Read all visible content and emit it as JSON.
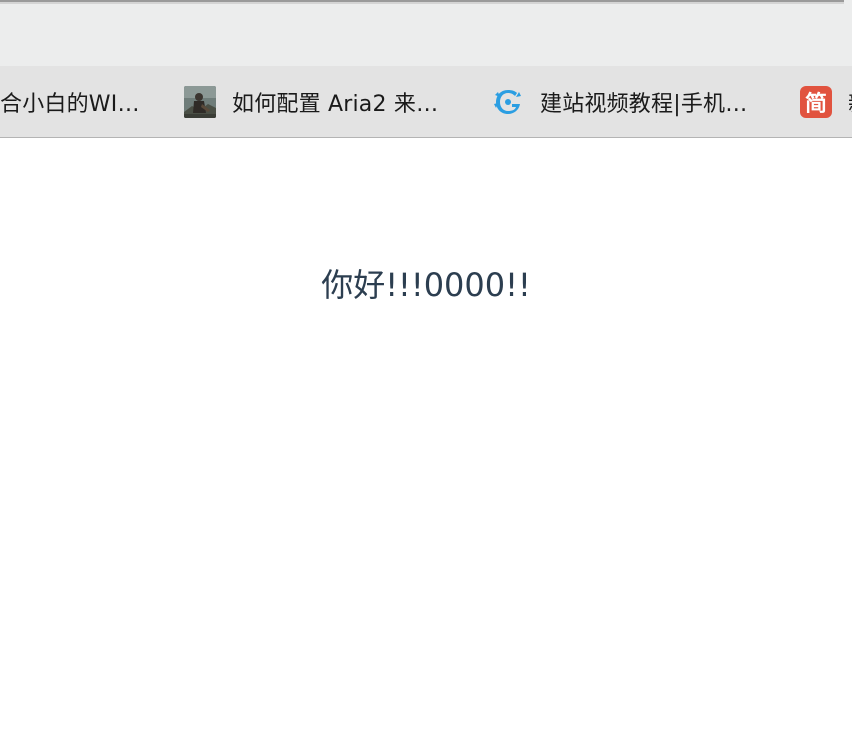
{
  "bookmarks": [
    {
      "label": "合小白的WI…",
      "icon": "none"
    },
    {
      "label": "如何配置 Aria2 来…",
      "icon": "photo-thumbnail-icon"
    },
    {
      "label": "建站视频教程|手机…",
      "icon": "blue-dragon-logo-icon"
    },
    {
      "label": "新",
      "icon": "jianshu-icon",
      "icon_text": "简"
    }
  ],
  "content": {
    "heading": "你好!!!0000!!"
  },
  "colors": {
    "toolbar_bg": "#eceded",
    "bookmarks_bg": "#e3e3e3",
    "heading_text": "#2c3e50",
    "jianshu_red": "#e1533f",
    "dragon_blue": "#2b9ee2"
  }
}
